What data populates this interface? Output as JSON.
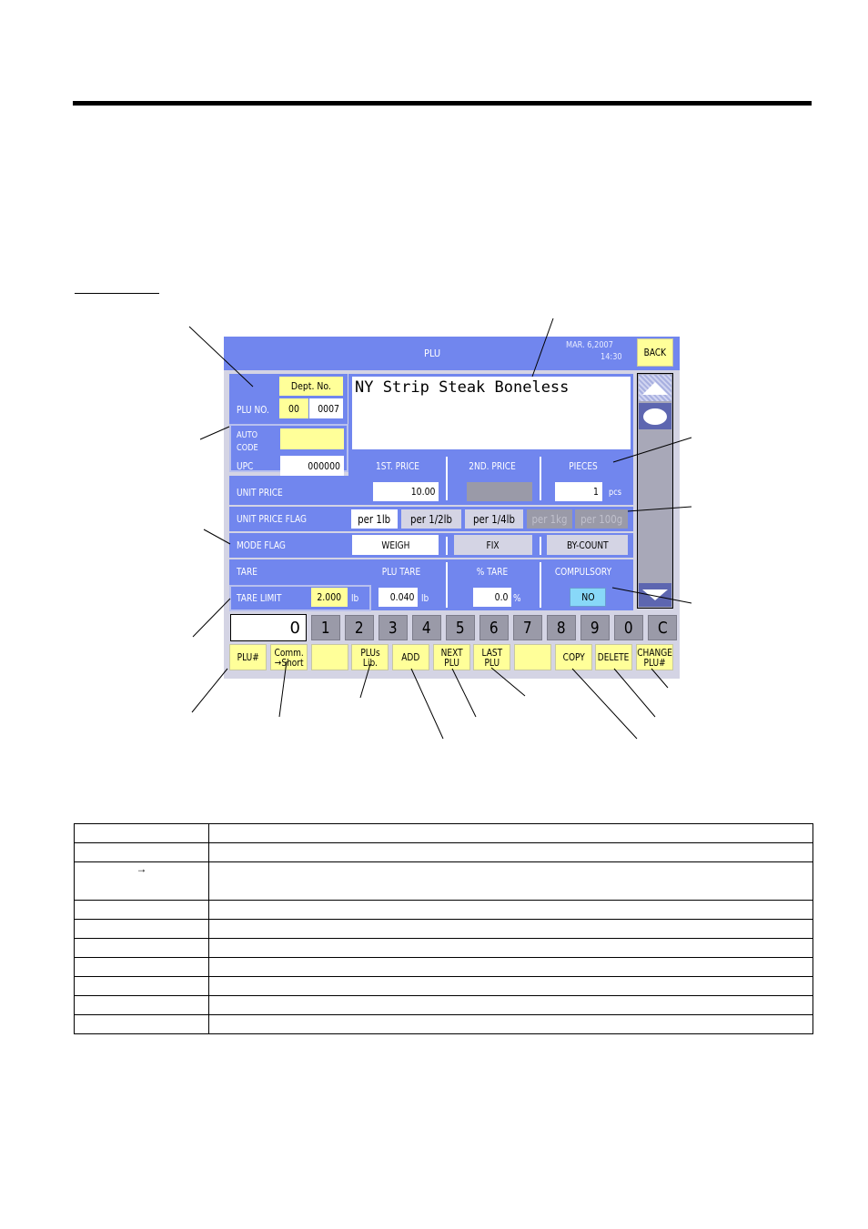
{
  "screen": {
    "title": "PLU",
    "date": "MAR. 6,2007",
    "time": "14:30",
    "back_label": "BACK",
    "plu_no": {
      "label": "PLU NO.",
      "dept_label": "Dept. No.",
      "dept_value": "00",
      "plu_value": "0007"
    },
    "commodity_name": "NY Strip Steak Boneless",
    "auto_code": {
      "label_line1": "AUTO",
      "label_line2": "CODE",
      "value": ""
    },
    "upc": {
      "label": "UPC",
      "value": "000000"
    },
    "price_headers": {
      "first": "1ST. PRICE",
      "second": "2ND. PRICE",
      "pieces": "PIECES"
    },
    "unit_price": {
      "label": "UNIT PRICE",
      "first_value": "10.00",
      "second_value": "",
      "pieces_value": "1",
      "pieces_unit": "pcs"
    },
    "unit_price_flag": {
      "label": "UNIT PRICE FLAG",
      "options": [
        {
          "label": "per 1lb",
          "state": "selected"
        },
        {
          "label": "per 1/2lb",
          "state": "normal"
        },
        {
          "label": "per 1/4lb",
          "state": "normal"
        },
        {
          "label": "per 1kg",
          "state": "disabled"
        },
        {
          "label": "per 100g",
          "state": "disabled"
        }
      ]
    },
    "mode_flag": {
      "label": "MODE FLAG",
      "options": [
        {
          "label": "WEIGH",
          "state": "selected"
        },
        {
          "label": "FIX",
          "state": "normal"
        },
        {
          "label": "BY-COUNT",
          "state": "normal"
        }
      ]
    },
    "tare": {
      "label": "TARE",
      "plu_tare_label": "PLU TARE",
      "percent_tare_label": "% TARE",
      "compulsory_label": "COMPULSORY",
      "tare_limit_label": "TARE LIMIT",
      "tare_limit_value": "2.000",
      "tare_limit_unit": "lb",
      "plu_tare_value": "0.040",
      "plu_tare_unit": "lb",
      "percent_tare_value": "0.0",
      "percent_tare_unit": "%",
      "compulsory_value": "NO"
    },
    "keypad": {
      "display": "0",
      "keys": [
        "1",
        "2",
        "3",
        "4",
        "5",
        "6",
        "7",
        "8",
        "9",
        "0",
        "C"
      ]
    },
    "function_keys": [
      "PLU#",
      "Comm.\n→Short",
      "",
      "PLUs\nLib.",
      "ADD",
      "NEXT\nPLU",
      "LAST\nPLU",
      "",
      "COPY",
      "DELETE",
      "CHANGE\nPLU#"
    ]
  },
  "table": {
    "rows": [
      [
        "",
        ""
      ],
      [
        "",
        ""
      ],
      [
        "→",
        ""
      ],
      [
        "",
        ""
      ],
      [
        "",
        ""
      ],
      [
        "",
        ""
      ],
      [
        "",
        ""
      ],
      [
        "",
        ""
      ],
      [
        "",
        ""
      ],
      [
        "",
        ""
      ]
    ]
  },
  "colors": {
    "screen_blue": "#7186ee",
    "button_yellow": "#ffff99",
    "key_gray": "#9a9aa8",
    "compulsory_cyan": "#88d8f8"
  }
}
